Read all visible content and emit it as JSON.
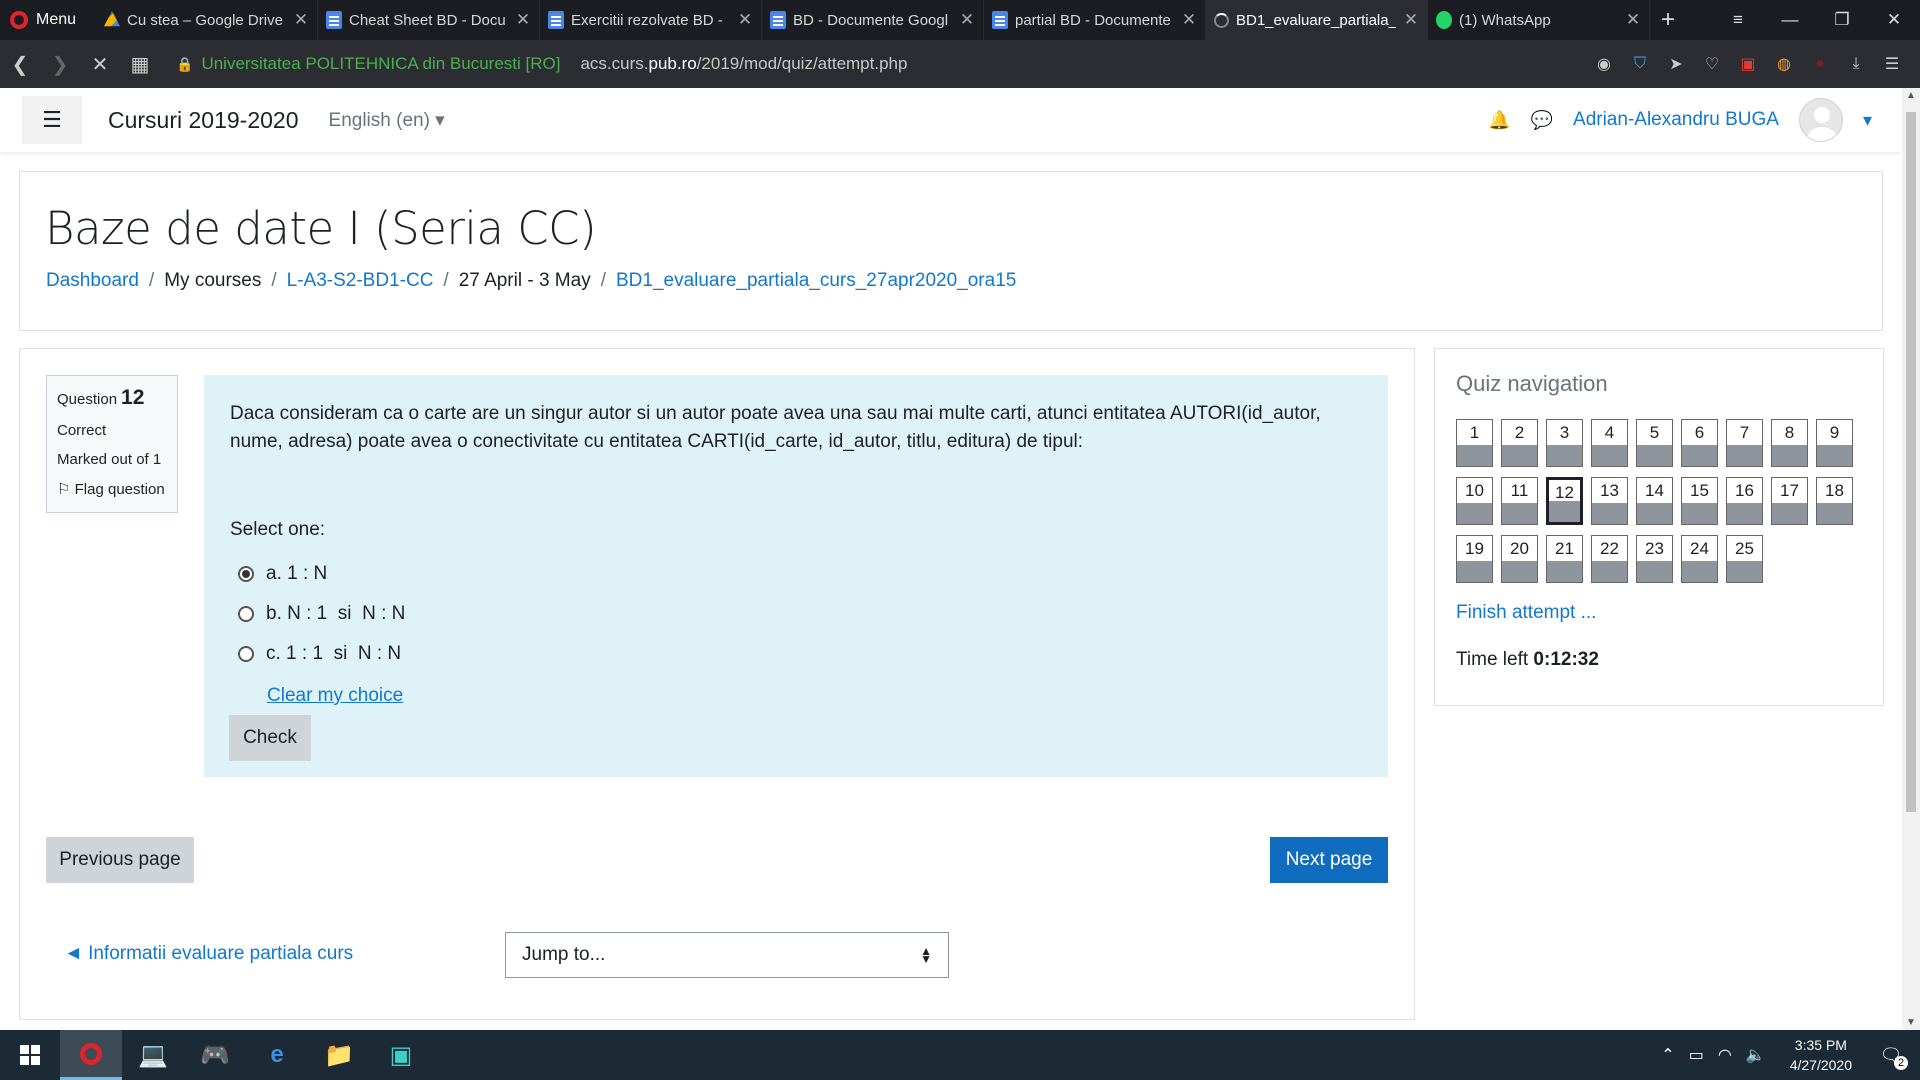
{
  "browser": {
    "menu_label": "Menu",
    "tabs": [
      {
        "title": "Cu stea – Google Drive",
        "icon": "drive-icon"
      },
      {
        "title": "Cheat Sheet BD - Docu",
        "icon": "docs-icon"
      },
      {
        "title": "Exercitii rezolvate BD - ",
        "icon": "docs-icon"
      },
      {
        "title": "BD - Documente Googl",
        "icon": "docs-icon"
      },
      {
        "title": "partial BD - Documente",
        "icon": "docs-icon"
      },
      {
        "title": "BD1_evaluare_partiala_",
        "icon": "loading-spinner-icon",
        "active": true
      },
      {
        "title": "(1) WhatsApp",
        "icon": "whatsapp-icon"
      }
    ],
    "site_org": "Universitatea POLITEHNICA din Bucuresti [RO]",
    "url_prefix": "acs.curs.",
    "url_domain": "pub.ro",
    "url_path": "/2019/mod/quiz/attempt.php"
  },
  "navbar": {
    "site_name": "Cursuri 2019-2020",
    "language": "English (en) ▾",
    "user_name": "Adrian-Alexandru BUGA"
  },
  "header": {
    "course_title": "Baze de date I (Seria CC)",
    "breadcrumb": [
      {
        "label": "Dashboard",
        "link": true
      },
      {
        "label": "My courses",
        "link": false
      },
      {
        "label": "L-A3-S2-BD1-CC",
        "link": true
      },
      {
        "label": "27 April - 3 May",
        "link": false
      },
      {
        "label": "BD1_evaluare_partiala_curs_27apr2020_ora15",
        "link": true
      }
    ],
    "separator": "/"
  },
  "question": {
    "label": "Question",
    "number": "12",
    "status": "Correct",
    "marks": "Marked out of 1",
    "flag_label": "Flag question",
    "text": "Daca consideram ca o carte are un singur autor si un autor poate avea una sau mai multe carti, atunci entitatea AUTORI(id_autor, nume, adresa) poate avea o conectivitate cu entitatea CARTI(id_carte, id_autor, titlu, editura) de tipul:",
    "select_one": "Select one:",
    "options": [
      {
        "label": "a. 1 : N",
        "checked": true
      },
      {
        "label": "b. N : 1  si  N : N",
        "checked": false
      },
      {
        "label": "c. 1 : 1  si  N : N",
        "checked": false
      }
    ],
    "clear_choice": "Clear my choice",
    "check_button": "Check"
  },
  "navigation": {
    "previous_page": "Previous page",
    "next_page": "Next page",
    "activity_link": "◄ Informatii evaluare partiala curs",
    "jump_to": "Jump to..."
  },
  "quiz_nav": {
    "title": "Quiz navigation",
    "questions": [
      "1",
      "2",
      "3",
      "4",
      "5",
      "6",
      "7",
      "8",
      "9",
      "10",
      "11",
      "12",
      "13",
      "14",
      "15",
      "16",
      "17",
      "18",
      "19",
      "20",
      "21",
      "22",
      "23",
      "24",
      "25"
    ],
    "current": "12",
    "finish_attempt": "Finish attempt ...",
    "time_left_label": "Time left",
    "time_left_value": "0:12:32"
  },
  "taskbar": {
    "time": "3:35 PM",
    "date": "4/27/2020",
    "notifications": "2"
  },
  "colors": {
    "link": "#1177d1",
    "primary_button": "#0f6cbf",
    "question_bg": "#def2f8",
    "browser_dark": "#1c1d22"
  }
}
